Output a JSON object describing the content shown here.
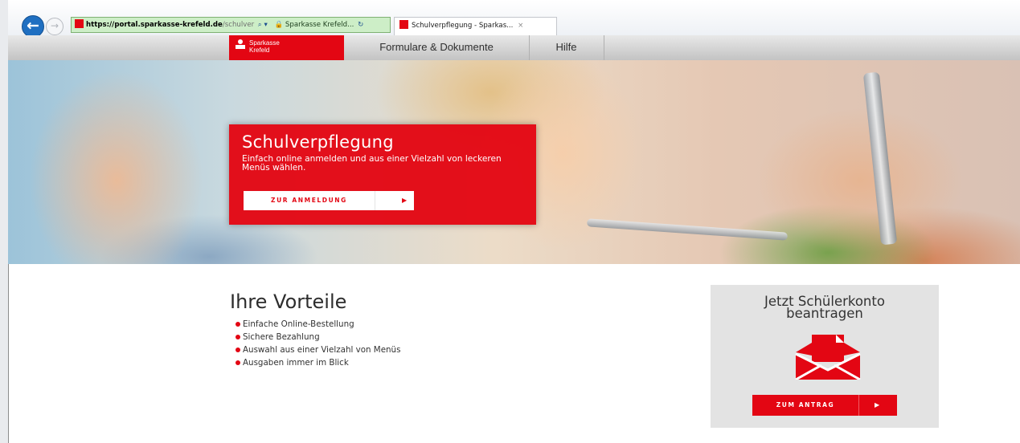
{
  "browser": {
    "url_host": "https://portal.sparkasse-krefeld.de",
    "url_path": "/schulver",
    "address_controls": "⌕ ▾",
    "site_identity": "🔒 Sparkasse Krefeld...",
    "refresh_glyph": "↻",
    "tab_title": "Schulverpflegung - Sparkas...",
    "tab_close": "×",
    "back_glyph": "←",
    "forward_glyph": "→"
  },
  "nav": {
    "brand": "Sparkasse Krefeld",
    "brand_lines": [
      "Sparkasse",
      "Krefeld"
    ],
    "items": [
      "Formulare & Dokumente",
      "Hilfe"
    ]
  },
  "hero": {
    "title": "Schulverpflegung",
    "subtitle": "Einfach online anmelden und aus einer Vielzahl von leckeren Menüs wählen.",
    "button_label": "ZUR ANMELDUNG",
    "button_arrow": "▶"
  },
  "vorteile": {
    "title": "Ihre Vorteile",
    "items": [
      "Einfache Online-Bestellung",
      "Sichere Bezahlung",
      "Auswahl aus einer Vielzahl von Menüs",
      "Ausgaben immer im Blick"
    ]
  },
  "antrag": {
    "title_line1": "Jetzt Schülerkonto",
    "title_line2": "beantragen",
    "button_label": "ZUM ANTRAG",
    "button_arrow": "▶",
    "icon": "envelope-icon"
  },
  "colors": {
    "brand_red": "#e30613",
    "text_dark": "#2d2d2d",
    "box_grey": "#e3e3e3"
  }
}
